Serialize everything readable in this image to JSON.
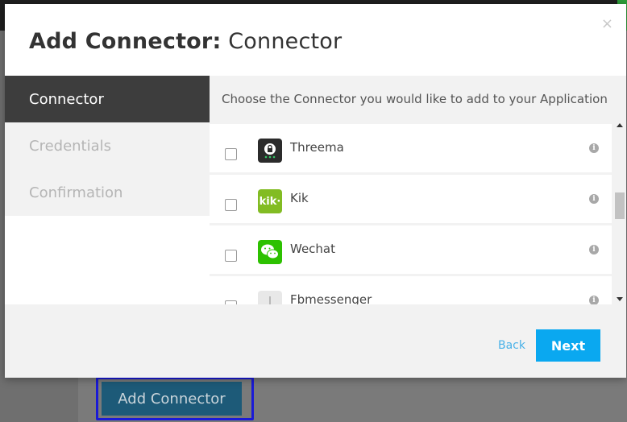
{
  "background": {
    "add_connector_label": "Add Connector"
  },
  "modal": {
    "title_bold": "Add Connector:",
    "title_normal": "Connector",
    "close_glyph": "×"
  },
  "sidebar": {
    "items": [
      {
        "label": "Connector",
        "active": true
      },
      {
        "label": "Credentials",
        "active": false
      },
      {
        "label": "Confirmation",
        "active": false
      }
    ]
  },
  "content": {
    "hint": "Choose the Connector you would like to add to your Application",
    "connectors": [
      {
        "name": "Threema",
        "icon": "threema-logo-icon",
        "checked": false
      },
      {
        "name": "Kik",
        "icon": "kik-logo-icon",
        "logo_text": "kik·",
        "checked": false
      },
      {
        "name": "Wechat",
        "icon": "wechat-logo-icon",
        "checked": false
      },
      {
        "name": "Fbmessenger",
        "icon": "fbmessenger-logo-icon",
        "checked": false
      }
    ],
    "info_glyph": "i"
  },
  "footer": {
    "back_label": "Back",
    "next_label": "Next"
  },
  "colors": {
    "accent": "#0aa8f0",
    "link": "#4ab2e8",
    "sidebar_active": "#3d3d3d",
    "kik_green": "#82bc23",
    "wechat_green": "#2dc100",
    "threema_dark": "#2b2b2b"
  }
}
